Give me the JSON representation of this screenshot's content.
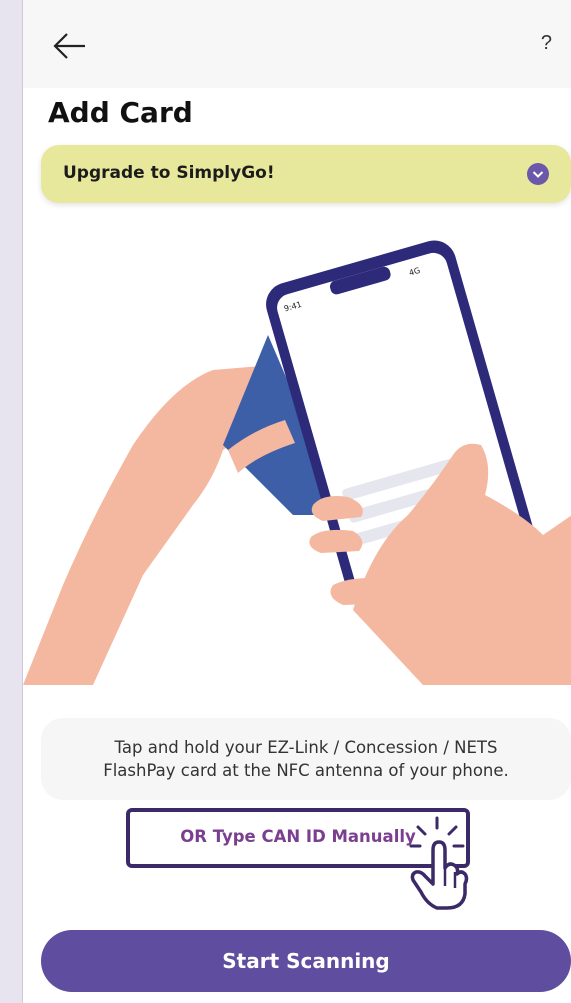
{
  "header": {
    "back_icon": "arrow-left-icon",
    "help_label": "?"
  },
  "page": {
    "title": "Add Card"
  },
  "upgrade_banner": {
    "label": "Upgrade to SimplyGo!",
    "icon": "chevron-down-icon",
    "background": "#e8e89c",
    "icon_color": "#6b58a8"
  },
  "illustration": {
    "status_time": "9:41",
    "status_network": "4G"
  },
  "instructions": {
    "line1": "Tap and hold your EZ-Link / Concession / NETS",
    "line2": "FlashPay card at the NFC antenna of your phone."
  },
  "manual_entry": {
    "label": "OR Type CAN ID Manually",
    "icon": "hand-pointer-icon"
  },
  "footer": {
    "start_label": "Start Scanning",
    "button_color": "#5f4d9f"
  }
}
